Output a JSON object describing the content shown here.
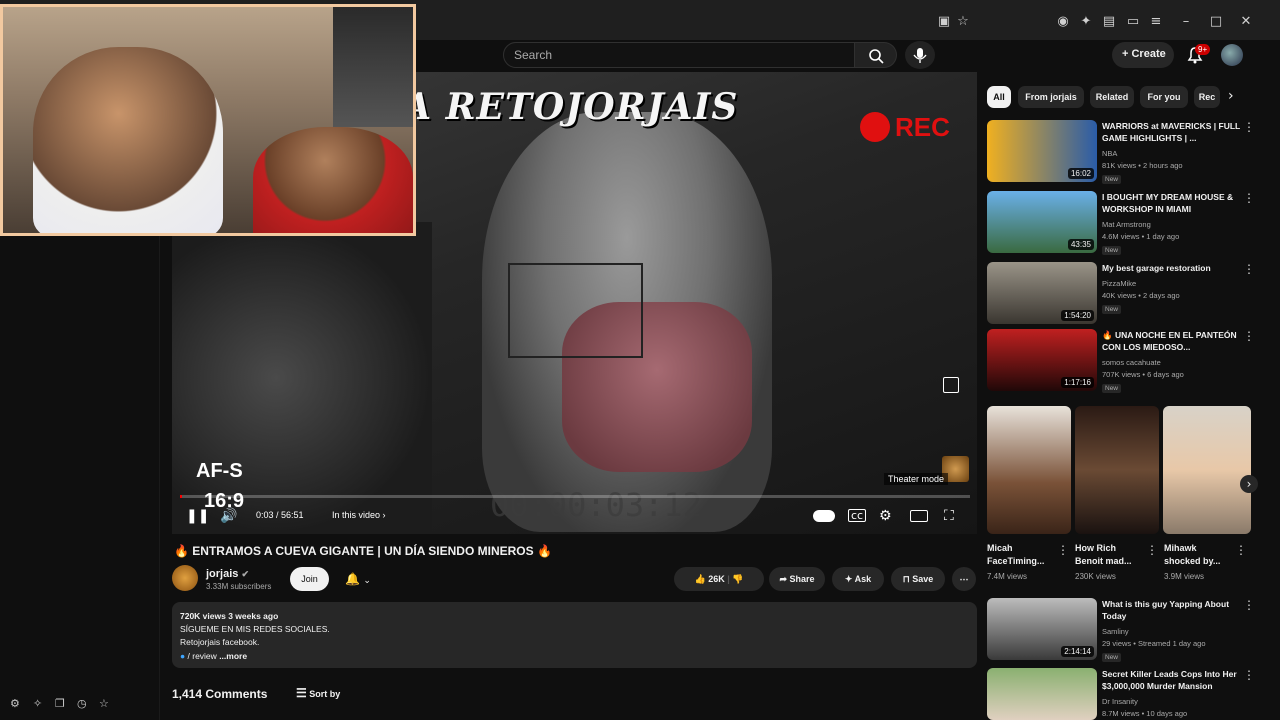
{
  "header": {
    "search_placeholder": "Search",
    "create_label": "Create",
    "notification_badge": "9+"
  },
  "player": {
    "overlay_title": "CAMARA RETOJORJAIS",
    "rec_label": "REC",
    "af_label": "AF-S",
    "ratio_label": "16:9",
    "timecode_overlay": "00:00:03:12",
    "time_display": "0:03 / 56:51",
    "in_this_video": "In this video",
    "theater_tooltip": "Theater mode",
    "progress_fraction": 0.001
  },
  "video": {
    "title": "🔥 ENTRAMOS A CUEVA GIGANTE | UN DÍA SIENDO MINEROS 🔥",
    "channel_name": "jorjais",
    "subscribers": "3.33M subscribers",
    "join_label": "Join",
    "like_count": "26K",
    "share_label": "Share",
    "ask_label": "Ask",
    "save_label": "Save",
    "views_age": "720K views  3 weeks ago",
    "desc_line1": "SÍGUEME EN MIS REDES SOCIALES.",
    "desc_line2": "Retojorjais facebook.",
    "desc_line3": "/ review",
    "more_label": "...more",
    "comments_count": "1,414 Comments",
    "sort_label": "Sort by"
  },
  "chips": [
    "All",
    "From jorjais",
    "Related",
    "For you",
    "Rec"
  ],
  "recommendations": [
    {
      "title": "WARRIORS at MAVERICKS | FULL GAME HIGHLIGHTS | ...",
      "channel": "NBA",
      "meta": "81K views • 2 hours ago",
      "badge": "New",
      "duration": "16:02",
      "color": "#2a5ca8"
    },
    {
      "title": "I BOUGHT MY DREAM HOUSE & WORKSHOP IN MIAMI",
      "channel": "Mat Armstrong",
      "meta": "4.6M views • 1 day ago",
      "badge": "New",
      "duration": "43:35",
      "color": "#3a8ad0"
    },
    {
      "title": "My best garage restoration",
      "channel": "PizzaMike",
      "meta": "40K views • 2 days ago",
      "badge": "New",
      "duration": "1:54:20",
      "color": "#6a6a60"
    },
    {
      "title": "🔥 UNA NOCHE EN EL PANTEÓN CON LOS MIEDOSO...",
      "channel": "somos cacahuate",
      "meta": "707K views • 6 days ago",
      "badge": "New",
      "duration": "1:17:16",
      "color": "#8a1818"
    },
    {
      "title": "What is this guy Yapping About Today",
      "channel": "Samliny",
      "meta": "29 views • Streamed 1 day ago",
      "badge": "New",
      "duration": "2:14:14",
      "color": "#444444"
    },
    {
      "title": "Secret Killer Leads Cops Into Her $3,000,000 Murder Mansion",
      "channel": "Dr Insanity",
      "meta": "8.7M views • 10 days ago",
      "badge": "",
      "duration": "",
      "color": "#5a7a3a"
    }
  ],
  "shorts": [
    {
      "title": "Micah FaceTiming...",
      "views": "7.4M views",
      "color": "#6b4a30"
    },
    {
      "title": "How Rich Benoit mad...",
      "views": "230K views",
      "color": "#3a2a22"
    },
    {
      "title": "Mihawk shocked by...",
      "views": "3.9M views",
      "color": "#c8c0b8"
    }
  ]
}
